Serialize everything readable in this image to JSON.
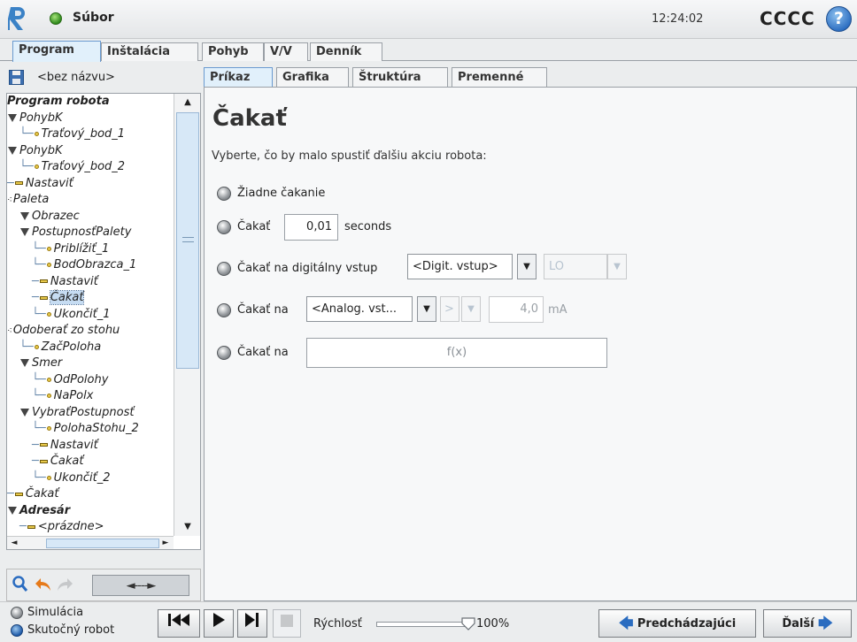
{
  "header": {
    "title": "Súbor",
    "time": "12:24:02",
    "robot_name": "CCCC",
    "help_glyph": "?"
  },
  "top_tabs": [
    "Program",
    "Inštalácia",
    "Pohyb",
    "V/V",
    "Denník"
  ],
  "top_tabs_active": "Program",
  "program": {
    "file_name": "<bez názvu>",
    "tree": [
      {
        "label": "Program robota",
        "mark": "none",
        "bold": true
      },
      {
        "label": "PohybK",
        "mark": "tri"
      },
      {
        "label": "Traťový_bod_1",
        "mark": "wp"
      },
      {
        "label": "PohybK",
        "mark": "tri"
      },
      {
        "label": "Traťový_bod_2",
        "mark": "wp"
      },
      {
        "label": "Nastaviť",
        "mark": "set"
      },
      {
        "label": "Paleta",
        "mark": "pal"
      },
      {
        "label": "Obrazec",
        "mark": "tri"
      },
      {
        "label": "PostupnosťPalety",
        "mark": "tri"
      },
      {
        "label": "Priblížiť_1",
        "mark": "wp"
      },
      {
        "label": "BodObrazca_1",
        "mark": "wp"
      },
      {
        "label": "Nastaviť",
        "mark": "set"
      },
      {
        "label": "Čakať",
        "mark": "set",
        "selected": true
      },
      {
        "label": "Ukončiť_1",
        "mark": "wp"
      },
      {
        "label": "Odoberať zo stohu",
        "mark": "pal"
      },
      {
        "label": "ZačPoloha",
        "mark": "wp"
      },
      {
        "label": "Smer",
        "mark": "tri"
      },
      {
        "label": "OdPolohy",
        "mark": "wp"
      },
      {
        "label": "NaPolx",
        "mark": "wp"
      },
      {
        "label": "VybraťPostupnosť",
        "mark": "tri"
      },
      {
        "label": "PolohaStohu_2",
        "mark": "wp"
      },
      {
        "label": "Nastaviť",
        "mark": "set"
      },
      {
        "label": "Čakať",
        "mark": "set"
      },
      {
        "label": "Ukončiť_2",
        "mark": "wp"
      },
      {
        "label": "Čakať",
        "mark": "set"
      },
      {
        "label": "Adresár",
        "mark": "tri",
        "bold": true
      },
      {
        "label": "<prázdne>",
        "mark": "set"
      }
    ],
    "tools": {
      "move_label": "◄----►"
    }
  },
  "sub_tabs": [
    "Príkaz",
    "Grafika",
    "Štruktúra",
    "Premenné"
  ],
  "sub_tabs_active": "Príkaz",
  "command": {
    "title": "Čakať",
    "subtitle": "Vyberte, čo by malo spustiť ďalšiu akciu robota:",
    "options": {
      "no_wait": "Žiadne čakanie",
      "wait": "Čakať",
      "wait_value": "0,01",
      "wait_unit": "seconds",
      "digital": "Čakať na digitálny vstup",
      "digital_select": "<Digit. vstup>",
      "digital_level": "LO",
      "analog": "Čakať na",
      "analog_select": "<Analog. vst...",
      "analog_op": ">",
      "analog_value": "4,0",
      "analog_unit": "mA",
      "expr": "Čakať na",
      "expr_placeholder": "f(x)"
    }
  },
  "footer": {
    "sim_label": "Simulácia",
    "real_label": "Skutočný robot",
    "speed_label": "Rýchlosť",
    "speed_value": "100%",
    "speed_fraction": 1.0,
    "prev_label": "Predchádzajúci",
    "next_label": "Ďalší"
  }
}
